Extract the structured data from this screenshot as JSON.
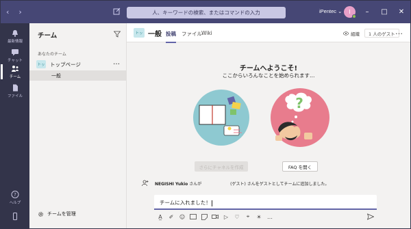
{
  "window": {
    "search_placeholder": "人、キーワードの検索、またはコマンドの入力",
    "user_name": "iPentec",
    "avatar_initial": "I",
    "controls": [
      "minimize",
      "maximize",
      "close"
    ]
  },
  "rail": {
    "items": [
      {
        "label": "最新情報",
        "icon": "bell-icon"
      },
      {
        "label": "チャット",
        "icon": "chat-icon"
      },
      {
        "label": "チーム",
        "icon": "teams-icon",
        "active": true
      },
      {
        "label": "ファイル",
        "icon": "file-icon"
      }
    ],
    "help_label": "ヘルプ"
  },
  "teams": {
    "title": "チーム",
    "section_label": "あなたのチーム",
    "team": {
      "badge": "トッ",
      "name": "トップページ"
    },
    "channel": "一般",
    "manage_label": "チームを管理"
  },
  "channel": {
    "badge": "トッ",
    "title": "一般",
    "tabs": [
      "投稿",
      "ファイル",
      "Wiki"
    ],
    "org_label": "組織",
    "guest_label": "1 人のゲスト",
    "welcome_title": "チームへようこそ!",
    "welcome_sub": "ここからいろんなことを始められます…",
    "create_channel_button": "さらにチャネルを作成",
    "faq_button": "FAQ を開く",
    "activity_name": "NEGISHI Yukio",
    "activity_text_1": " さんが",
    "activity_guest": "(ゲスト)",
    "activity_text_2": " さんをゲストとしてチームに追加しました。",
    "compose_text": "チームに入れました！",
    "colors": {
      "accent": "#6264a7",
      "titlebar": "#464775",
      "rail": "#33344a",
      "teal": "#8ec9d1",
      "pink": "#e87c8d"
    }
  }
}
